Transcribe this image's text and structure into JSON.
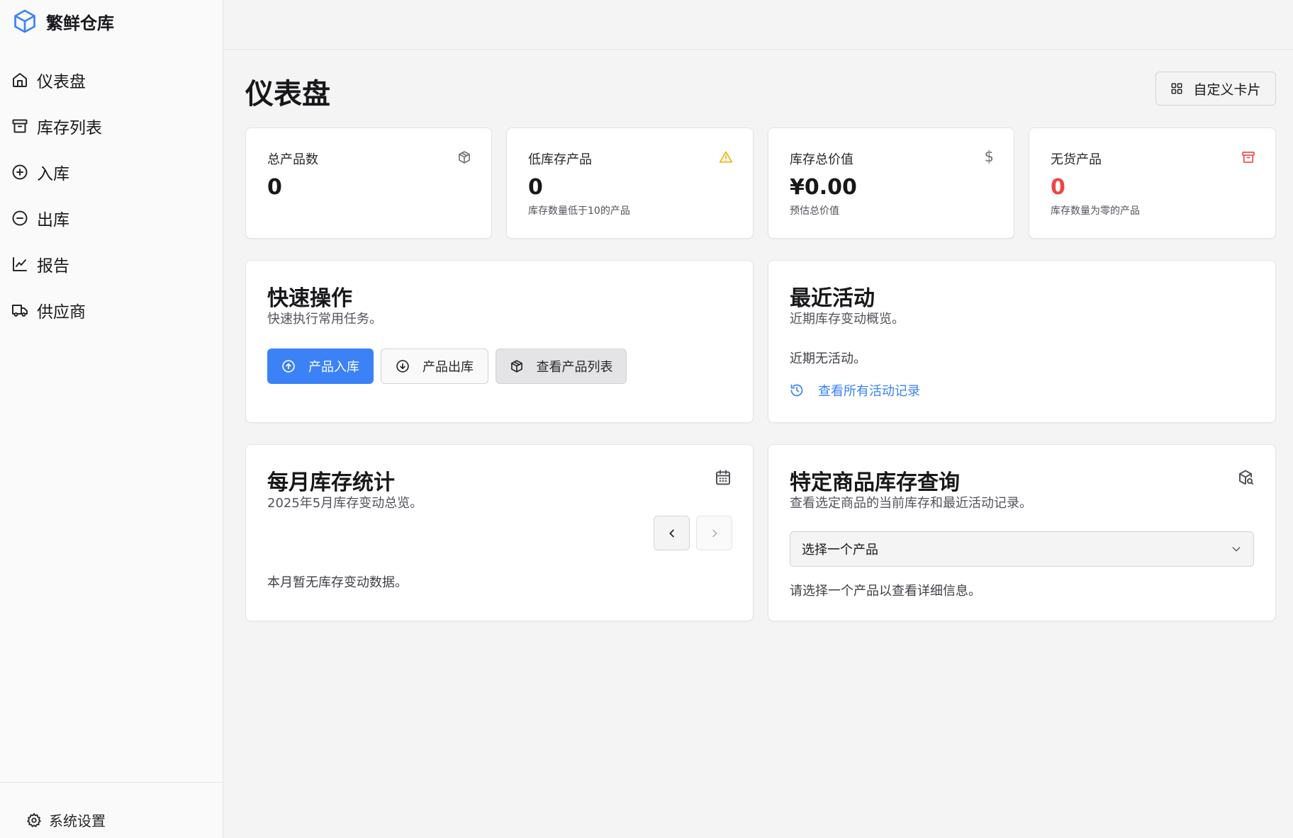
{
  "brand": {
    "name": "繁鲜仓库"
  },
  "sidebar": {
    "items": [
      {
        "label": "仪表盘",
        "icon": "home-icon"
      },
      {
        "label": "库存列表",
        "icon": "archive-icon"
      },
      {
        "label": "入库",
        "icon": "plus-circle-icon"
      },
      {
        "label": "出库",
        "icon": "minus-circle-icon"
      },
      {
        "label": "报告",
        "icon": "line-chart-icon"
      },
      {
        "label": "供应商",
        "icon": "truck-icon"
      }
    ],
    "footer": {
      "label": "系统设置",
      "icon": "gear-icon"
    }
  },
  "page": {
    "title": "仪表盘",
    "customize_label": "自定义卡片"
  },
  "stats": [
    {
      "label": "总产品数",
      "value": "0",
      "sub": "",
      "icon": "package-icon"
    },
    {
      "label": "低库存产品",
      "value": "0",
      "sub": "库存数量低于10的产品",
      "icon": "warning-icon"
    },
    {
      "label": "库存总价值",
      "value": "¥0.00",
      "sub": "预估总价值",
      "icon": "dollar-icon"
    },
    {
      "label": "无货产品",
      "value": "0",
      "sub": "库存数量为零的产品",
      "icon": "archive-icon"
    }
  ],
  "quick_actions": {
    "title": "快速操作",
    "desc": "快速执行常用任务。",
    "stock_in": "产品入库",
    "stock_out": "产品出库",
    "view_list": "查看产品列表"
  },
  "recent": {
    "title": "最近活动",
    "desc": "近期库存变动概览。",
    "empty": "近期无活动。",
    "link": "查看所有活动记录"
  },
  "monthly": {
    "title": "每月库存统计",
    "desc": "2025年5月库存变动总览。",
    "empty": "本月暂无库存变动数据。"
  },
  "lookup": {
    "title": "特定商品库存查询",
    "desc": "查看选定商品的当前库存和最近活动记录。",
    "select_placeholder": "选择一个产品",
    "hint": "请选择一个产品以查看详细信息。"
  },
  "colors": {
    "accent": "#3b82f6",
    "warning": "#eab308",
    "danger": "#ef4444"
  }
}
